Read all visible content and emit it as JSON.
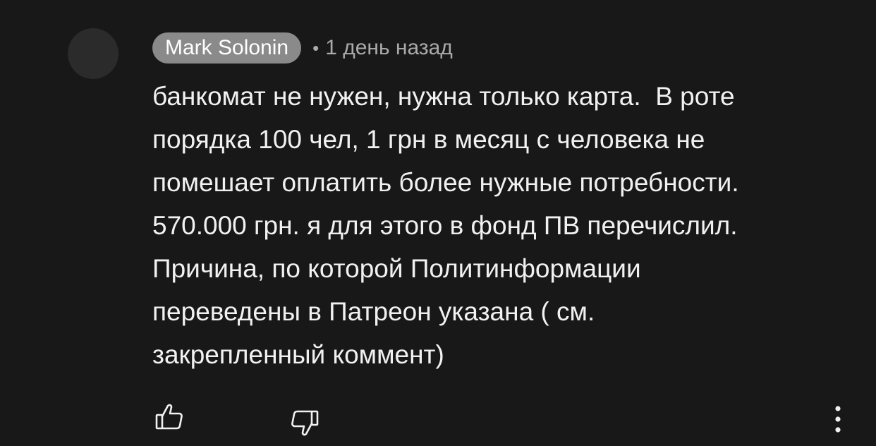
{
  "comment": {
    "author": "Mark Solonin",
    "separator": "•",
    "timestamp": "1 день назад",
    "text": "банкомат не нужен, нужна только карта.  В роте\nпорядка 100 чел, 1 грн в месяц с человека не\nпомешает оплатить более нужные потребности.\n570.000 грн. я для этого в фонд ПВ перечислил.\nПричина, по которой Политинформации\nпереведены в Патреон указана ( см.\nзакрепленный коммент)"
  },
  "actions": {
    "like_icon": "thumbs-up-outline",
    "dislike_icon": "thumbs-down-outline",
    "more_icon": "vertical-ellipsis"
  },
  "colors": {
    "background": "#181818",
    "avatar": "#2b2b2b",
    "author_chip": "#8a8a8a",
    "text": "#f1f1f1",
    "secondary_text": "#aaaaaa"
  }
}
